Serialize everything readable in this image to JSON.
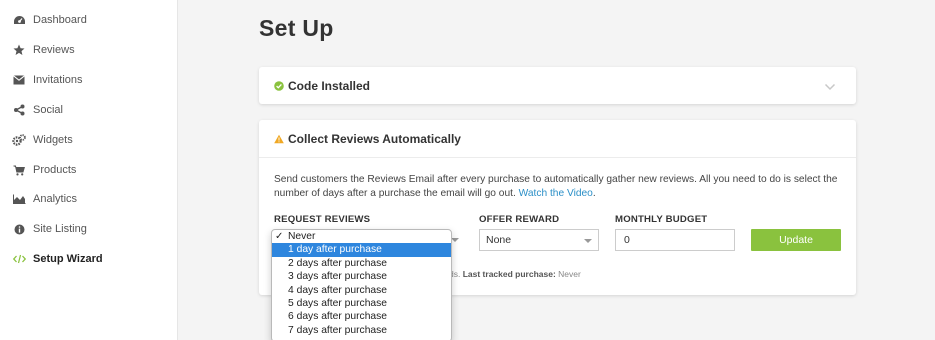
{
  "sidebar": {
    "items": [
      {
        "label": "Dashboard",
        "icon": "dashboard-icon"
      },
      {
        "label": "Reviews",
        "icon": "star-icon"
      },
      {
        "label": "Invitations",
        "icon": "envelope-icon"
      },
      {
        "label": "Social",
        "icon": "share-icon"
      },
      {
        "label": "Widgets",
        "icon": "gears-icon"
      },
      {
        "label": "Products",
        "icon": "cart-icon"
      },
      {
        "label": "Analytics",
        "icon": "area-chart-icon"
      },
      {
        "label": "Site Listing",
        "icon": "info-icon"
      },
      {
        "label": "Setup Wizard",
        "icon": "code-icon",
        "active": true
      }
    ]
  },
  "main": {
    "title": "Set Up",
    "code_card": {
      "title": "Code Installed"
    },
    "collect_card": {
      "title": "Collect Reviews Automatically",
      "description": "Send customers the Reviews Email after every purchase to automatically gather new reviews. All you need to do is select the number of days after a purchase the email will go out.",
      "link": "Watch the Video",
      "link_suffix": ".",
      "labels": {
        "request": "REQUEST REVIEWS",
        "offer": "OFFER REWARD",
        "budget": "MONTHLY BUDGET"
      },
      "offer_value": "None",
      "budget_value": "0",
      "update_label": "Update",
      "note_prefix": "ds.",
      "note_bold": "Last tracked purchase:",
      "note_value": "Never"
    },
    "request_dropdown": {
      "options": [
        "Never",
        "1 day after purchase",
        "2 days after purchase",
        "3 days after purchase",
        "4 days after purchase",
        "5 days after purchase",
        "6 days after purchase",
        "7 days after purchase"
      ],
      "checked": "Never",
      "highlighted": "1 day after purchase"
    }
  },
  "colors": {
    "accent_green": "#8ac23e",
    "link_blue": "#2b8fc7",
    "highlight_blue": "#2e86de",
    "warning": "#f0a824"
  }
}
